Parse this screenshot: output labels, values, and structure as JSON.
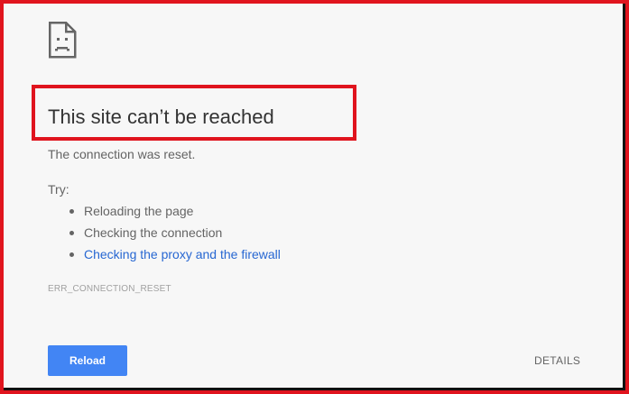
{
  "error_page": {
    "icon": "sad-document-icon",
    "title": "This site can’t be reached",
    "subtitle": "The connection was reset.",
    "try_label": "Try:",
    "suggestions": [
      {
        "label": "Reloading the page",
        "is_link": false
      },
      {
        "label": "Checking the connection",
        "is_link": false
      },
      {
        "label": "Checking the proxy and the firewall",
        "is_link": true
      }
    ],
    "error_code": "ERR_CONNECTION_RESET",
    "reload_label": "Reload",
    "details_label": "DETAILS"
  },
  "colors": {
    "highlight_border": "#e0141e",
    "background": "#f7f7f7",
    "link": "#2767d2",
    "button": "#4285f4",
    "text": "#646464",
    "title": "#333333"
  }
}
